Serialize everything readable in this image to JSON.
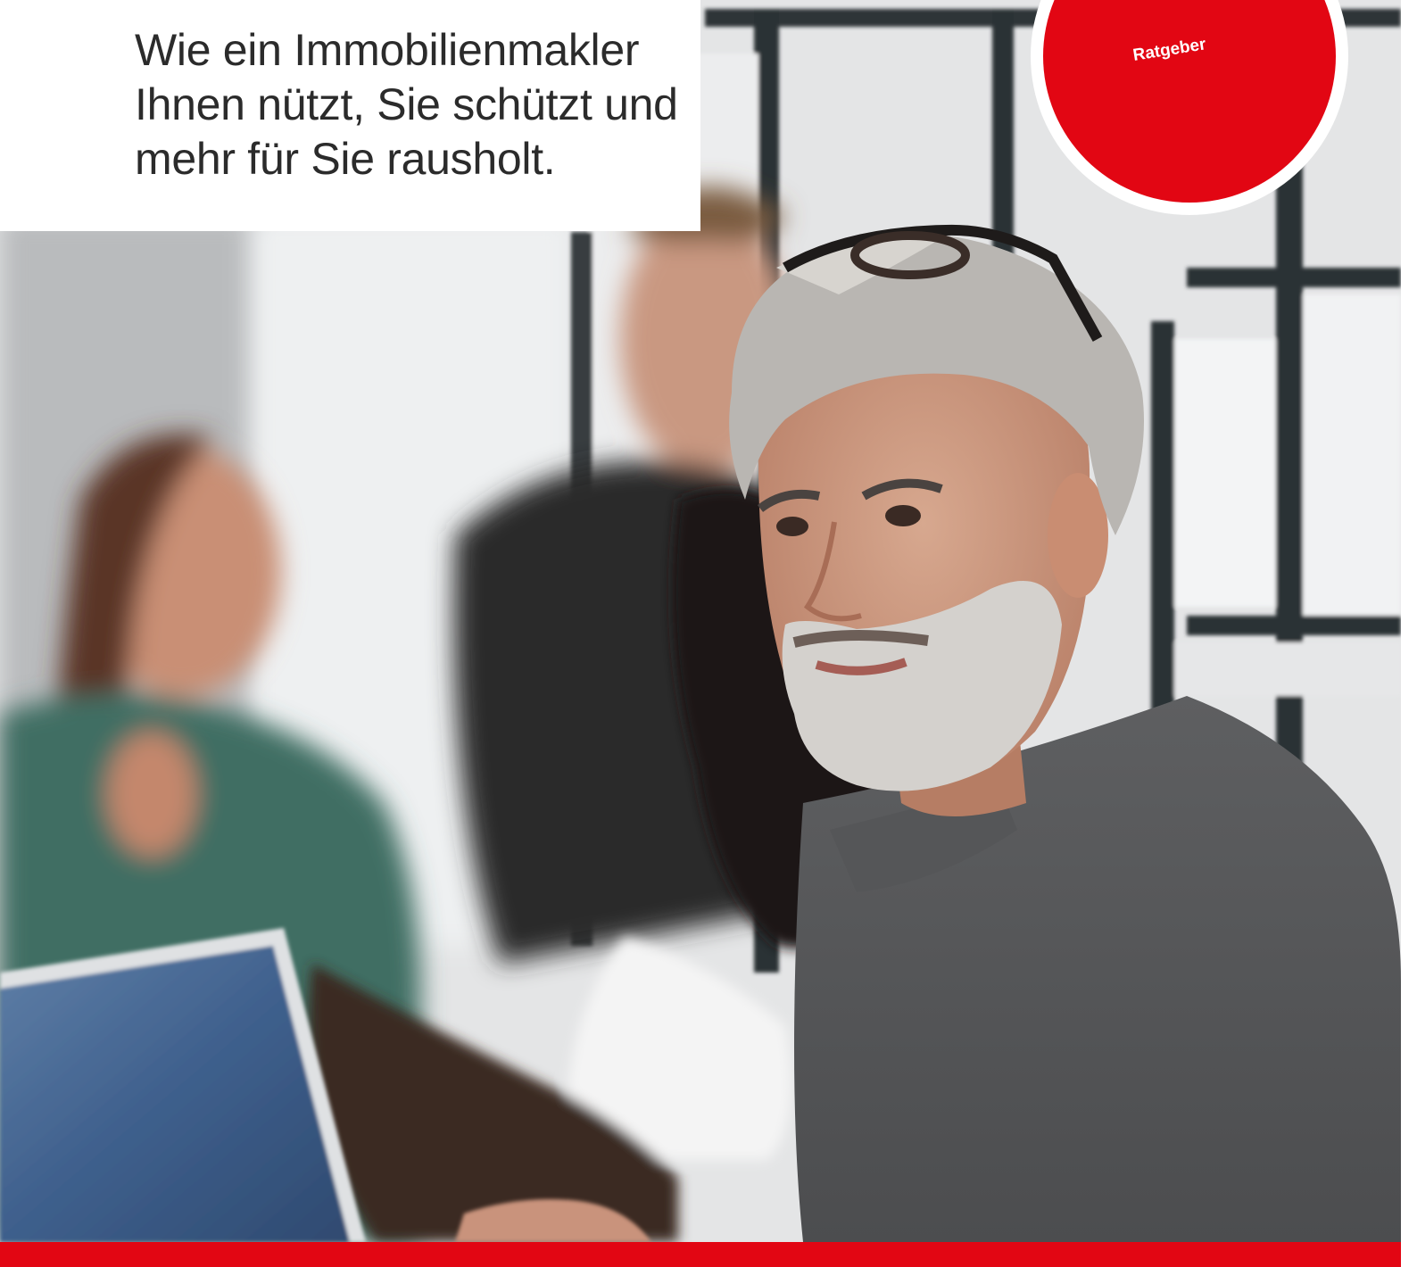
{
  "cover": {
    "headline_lines": [
      "Wie ein Immobilienmakler",
      "Ihnen nützt, Sie schützt und",
      "mehr für Sie rausholt."
    ],
    "badge_label": "Ratgeber"
  },
  "photo": {
    "subject": "office-meeting-photo"
  },
  "colors": {
    "accent_red": "#e20613",
    "text_dark": "#2b2b2b",
    "background": "#ffffff"
  }
}
